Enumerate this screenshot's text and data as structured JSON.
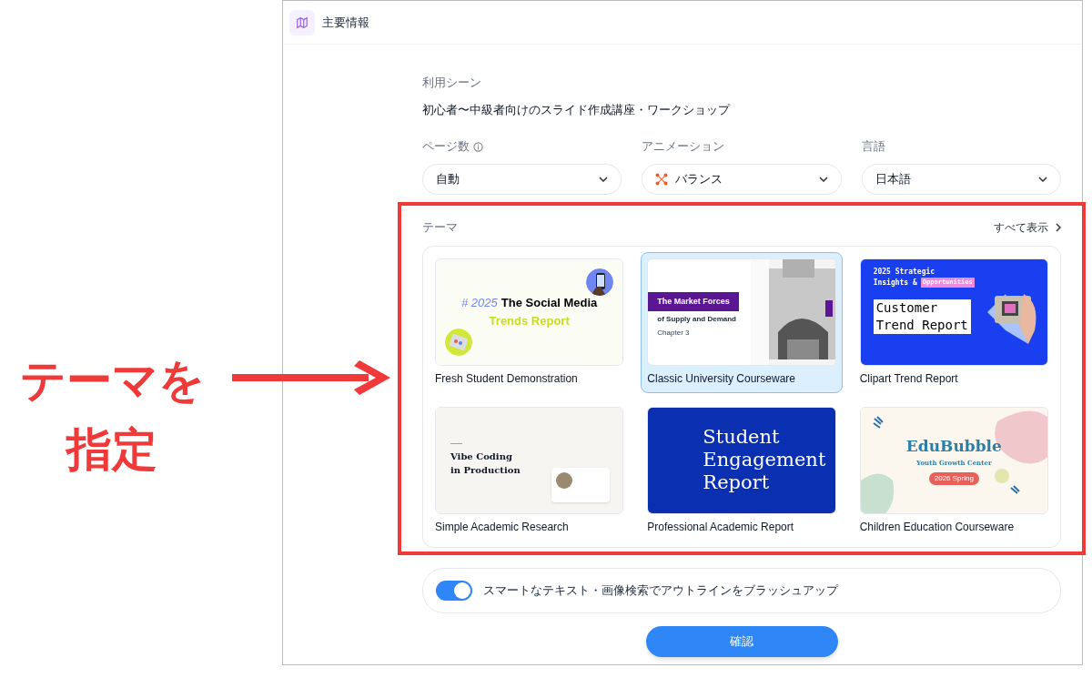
{
  "annotation": {
    "lines": [
      "テーマを",
      "指定"
    ]
  },
  "header": {
    "title": "主要情報"
  },
  "usage": {
    "label": "利用シーン",
    "value": "初心者〜中級者向けのスライド作成講座・ワークショップ"
  },
  "settings": [
    {
      "label": "ページ数",
      "info": true,
      "value": "自動",
      "icon": false
    },
    {
      "label": "アニメーション",
      "info": false,
      "value": "バランス",
      "icon": true
    },
    {
      "label": "言語",
      "info": false,
      "value": "日本語",
      "icon": false
    }
  ],
  "themes": {
    "label": "テーマ",
    "show_all": "すべて表示",
    "items": [
      {
        "name": "Fresh Student Demonstration",
        "selected": false,
        "thumbnail": {
          "kind": "social",
          "lines": [
            "# 2025",
            "The Social Media",
            "Trends Report"
          ]
        }
      },
      {
        "name": "Classic University Courseware",
        "selected": true,
        "thumbnail": {
          "kind": "university",
          "lines": [
            "The Market Forces",
            "of Supply and Demand",
            "Chapter 3"
          ]
        }
      },
      {
        "name": "Clipart Trend Report",
        "selected": false,
        "thumbnail": {
          "kind": "clipart",
          "lines": [
            "2025 Strategic",
            "Insights &",
            "Opportunities",
            "Customer\nTrend Report"
          ]
        }
      },
      {
        "name": "Simple Academic Research",
        "selected": false,
        "thumbnail": {
          "kind": "academic",
          "lines": [
            "Vibe Coding\nin Production"
          ]
        }
      },
      {
        "name": "Professional Academic Report",
        "selected": false,
        "thumbnail": {
          "kind": "engagement",
          "lines": [
            "Student\nEngagement\nReport"
          ]
        }
      },
      {
        "name": "Children Education Courseware",
        "selected": false,
        "thumbnail": {
          "kind": "edububble",
          "lines": [
            "EduBubble",
            "Youth Growth Center",
            "2026 Spring"
          ]
        }
      }
    ]
  },
  "smart_search": {
    "label": "スマートなテキスト・画像検索でアウトラインをブラッシュアップ",
    "on": true
  },
  "confirm": "確認"
}
